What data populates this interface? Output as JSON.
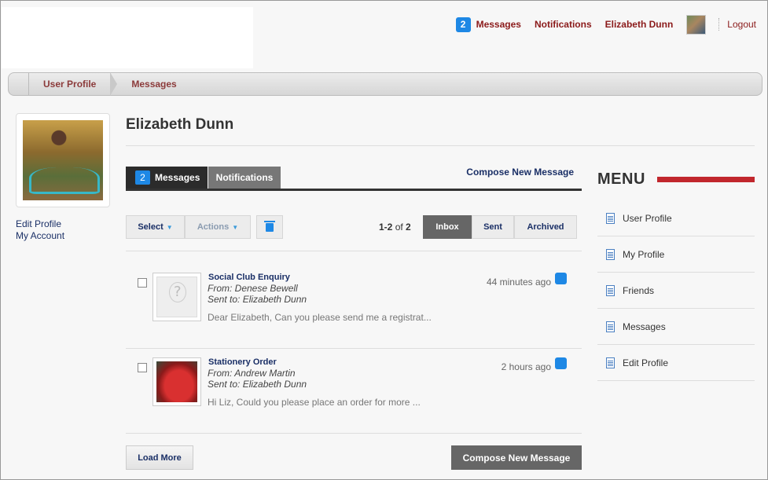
{
  "topnav": {
    "messages_count": "2",
    "messages": "Messages",
    "notifications": "Notifications",
    "user_name": "Elizabeth Dunn",
    "logout": "Logout"
  },
  "breadcrumb": [
    "User Profile",
    "Messages"
  ],
  "sidebar": {
    "edit_profile": "Edit Profile",
    "my_account": "My Account"
  },
  "page": {
    "title": "Elizabeth Dunn"
  },
  "tabs": {
    "messages_badge": "2",
    "messages": "Messages",
    "notifications": "Notifications",
    "compose_link": "Compose New Message"
  },
  "toolbar": {
    "select": "Select",
    "actions": "Actions",
    "count_range": "1-2",
    "count_of": "of",
    "count_total": "2",
    "inbox": "Inbox",
    "sent": "Sent",
    "archived": "Archived"
  },
  "messages": [
    {
      "subject": "Social Club Enquiry",
      "from": "From: Denese Bewell",
      "to": "Sent to: Elizabeth Dunn",
      "preview": "Dear Elizabeth, Can you please send me a registrat...",
      "time": "44 minutes ago"
    },
    {
      "subject": "Stationery Order",
      "from": "From: Andrew Martin",
      "to": "Sent to: Elizabeth Dunn",
      "preview": "Hi Liz, Could you please place an order for more ...",
      "time": "2 hours ago"
    }
  ],
  "footer": {
    "load_more": "Load More",
    "compose": "Compose New Message"
  },
  "menu": {
    "title": "MENU",
    "items": [
      "User Profile",
      "My Profile",
      "Friends",
      "Messages",
      "Edit Profile"
    ]
  },
  "colors": {
    "accent_blue": "#1e88e5",
    "link_red": "#8b1a1a",
    "menu_bar_red": "#c1272d",
    "dark_tab": "#2b2b2b"
  }
}
